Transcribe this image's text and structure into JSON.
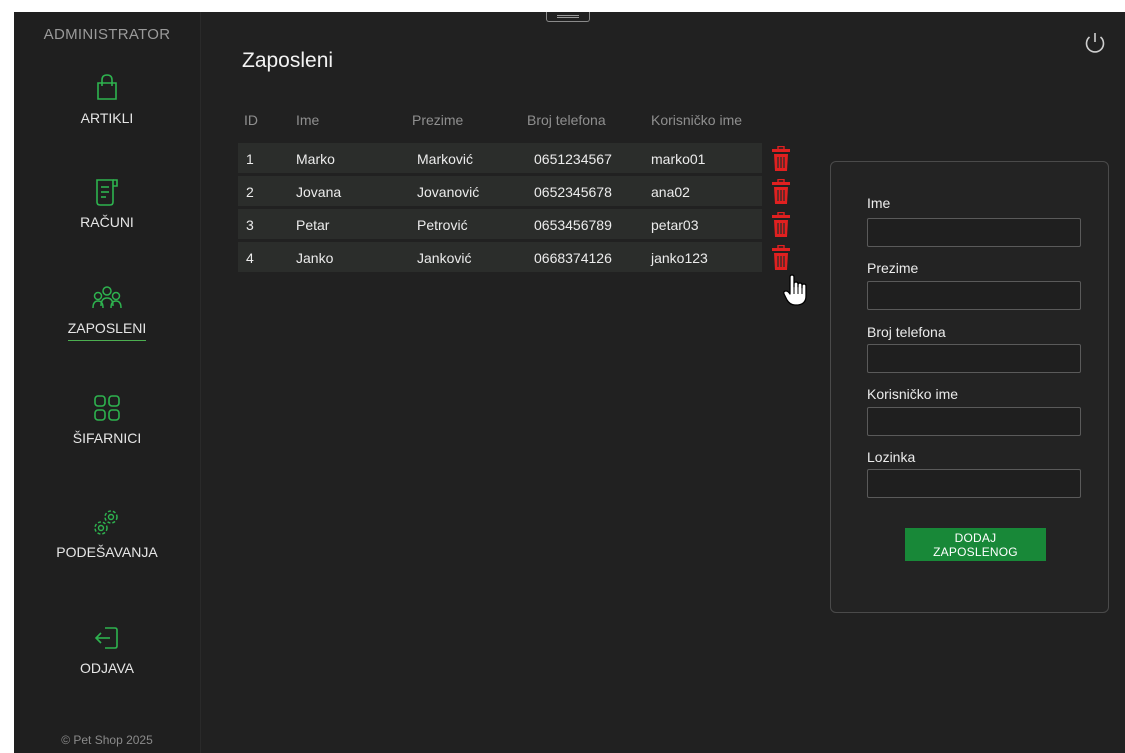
{
  "sidebar": {
    "title": "ADMINISTRATOR",
    "items": [
      {
        "label": "ARTIKLI",
        "icon": "shopping-bag-icon",
        "active": false
      },
      {
        "label": "RAČUNI",
        "icon": "receipt-icon",
        "active": false
      },
      {
        "label": "ZAPOSLENI",
        "icon": "users-icon",
        "active": true
      },
      {
        "label": "ŠIFARNICI",
        "icon": "grid-icon",
        "active": false
      },
      {
        "label": "PODEŠAVANJA",
        "icon": "gears-icon",
        "active": false
      },
      {
        "label": "ODJAVA",
        "icon": "logout-icon",
        "active": false
      }
    ],
    "footer": "© Pet Shop 2025"
  },
  "header": {
    "title": "Zaposleni",
    "power_icon": "power-icon"
  },
  "table": {
    "columns": [
      "ID",
      "Ime",
      "Prezime",
      "Broj telefona",
      "Korisničko ime"
    ],
    "rows": [
      {
        "id": "1",
        "ime": "Marko",
        "prezime": "Marković",
        "telefon": "0651234567",
        "korisnicko": "marko01"
      },
      {
        "id": "2",
        "ime": "Jovana",
        "prezime": "Jovanović",
        "telefon": "0652345678",
        "korisnicko": "ana02"
      },
      {
        "id": "3",
        "ime": "Petar",
        "prezime": "Petrović",
        "telefon": "0653456789",
        "korisnicko": "petar03"
      },
      {
        "id": "4",
        "ime": "Janko",
        "prezime": "Janković",
        "telefon": "0668374126",
        "korisnicko": "janko123"
      }
    ],
    "delete_icon": "trash-icon"
  },
  "form": {
    "fields": [
      {
        "label": "Ime",
        "value": "",
        "placeholder": ""
      },
      {
        "label": "Prezime",
        "value": "",
        "placeholder": ""
      },
      {
        "label": "Broj telefona",
        "value": "",
        "placeholder": ""
      },
      {
        "label": "Korisničko ime",
        "value": "",
        "placeholder": ""
      },
      {
        "label": "Lozinka",
        "value": "",
        "placeholder": ""
      }
    ],
    "submit_label": "DODAJ ZAPOSLENOG"
  },
  "colors": {
    "background": "#212121",
    "accent": "#1e8f3e",
    "danger": "#e02020",
    "text": "#ececec"
  }
}
